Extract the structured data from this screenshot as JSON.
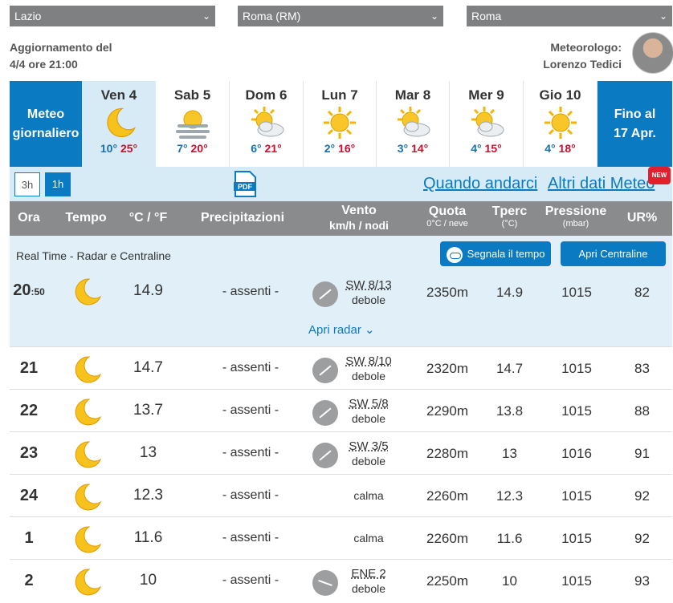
{
  "selectors": [
    {
      "value": "Lazio"
    },
    {
      "value": "Roma (RM)"
    },
    {
      "value": "Roma"
    }
  ],
  "update": {
    "line1": "Aggiornamento del",
    "line2": "4/4 ore 21:00"
  },
  "meteorologist": {
    "line1": "Meteorologo:",
    "line2": "Lorenzo Tedici"
  },
  "day_strip": {
    "left_label_1": "Meteo",
    "left_label_2": "giornaliero",
    "right_label_1": "Fino al",
    "right_label_2": "17 Apr.",
    "days": [
      {
        "name": "Ven 4",
        "icon": "moon-icon",
        "min": "10°",
        "max": "25°"
      },
      {
        "name": "Sab 5",
        "icon": "sun-fog-icon",
        "min": "7°",
        "max": "20°"
      },
      {
        "name": "Dom 6",
        "icon": "sun-cloud-icon",
        "min": "6°",
        "max": "21°"
      },
      {
        "name": "Lun 7",
        "icon": "sun-icon",
        "min": "2°",
        "max": "16°"
      },
      {
        "name": "Mar 8",
        "icon": "sun-cloud-icon",
        "min": "3°",
        "max": "14°"
      },
      {
        "name": "Mer 9",
        "icon": "sun-cloud-icon",
        "min": "4°",
        "max": "15°"
      },
      {
        "name": "Gio 10",
        "icon": "sun-icon",
        "min": "4°",
        "max": "18°"
      }
    ]
  },
  "toolbar": {
    "btn_3h": "3h",
    "btn_1h": "1h",
    "pdf": "PDF",
    "link_quando": "Quando andarci",
    "link_altri": "Altri dati Meteo",
    "new_badge": "NEW"
  },
  "header": {
    "ora": "Ora",
    "tempo": "Tempo",
    "temp": "°C / °F",
    "precip": "Precipitazioni",
    "vento": "Vento",
    "vento_sub": "km/h / nodi",
    "quota": "Quota",
    "quota_sub": "0°C / neve",
    "tperc": "Tperc",
    "tperc_sub": "(°C)",
    "pressione": "Pressione",
    "pressione_sub": "(mbar)",
    "ur": "UR%"
  },
  "realtime": {
    "label": "Real Time - Radar e Centraline",
    "segnala": "Segnala il tempo",
    "apri_centraline": "Apri Centraline",
    "apri_radar": "Apri radar",
    "row": {
      "hour": "20",
      "minute": ":50",
      "temp": "14.9",
      "precip": "- assenti -",
      "wind": "SW 8/13",
      "wind_desc": "debole",
      "quota": "2350m",
      "tperc": "14.9",
      "pres": "1015",
      "ur": "82"
    }
  },
  "rows": [
    {
      "hour": "21",
      "temp": "14.7",
      "precip": "- assenti -",
      "wind": "SW 8/10",
      "wind_desc": "debole",
      "quota": "2320m",
      "tperc": "14.7",
      "pres": "1015",
      "ur": "83"
    },
    {
      "hour": "22",
      "temp": "13.7",
      "precip": "- assenti -",
      "wind": "SW 5/8",
      "wind_desc": "debole",
      "quota": "2290m",
      "tperc": "13.8",
      "pres": "1015",
      "ur": "88"
    },
    {
      "hour": "23",
      "temp": "13",
      "precip": "- assenti -",
      "wind": "SW 3/5",
      "wind_desc": "debole",
      "quota": "2280m",
      "tperc": "13",
      "pres": "1016",
      "ur": "91"
    },
    {
      "hour": "24",
      "temp": "12.3",
      "precip": "- assenti -",
      "wind": "",
      "wind_desc": "calma",
      "quota": "2260m",
      "tperc": "12.3",
      "pres": "1015",
      "ur": "92"
    },
    {
      "hour": "1",
      "temp": "11.6",
      "precip": "- assenti -",
      "wind": "",
      "wind_desc": "calma",
      "quota": "2260m",
      "tperc": "11.6",
      "pres": "1015",
      "ur": "92"
    },
    {
      "hour": "2",
      "temp": "10",
      "precip": "- assenti -",
      "wind": "ENE 2",
      "wind_desc": "debole",
      "quota": "2250m",
      "tperc": "10",
      "pres": "1015",
      "ur": "93"
    }
  ]
}
